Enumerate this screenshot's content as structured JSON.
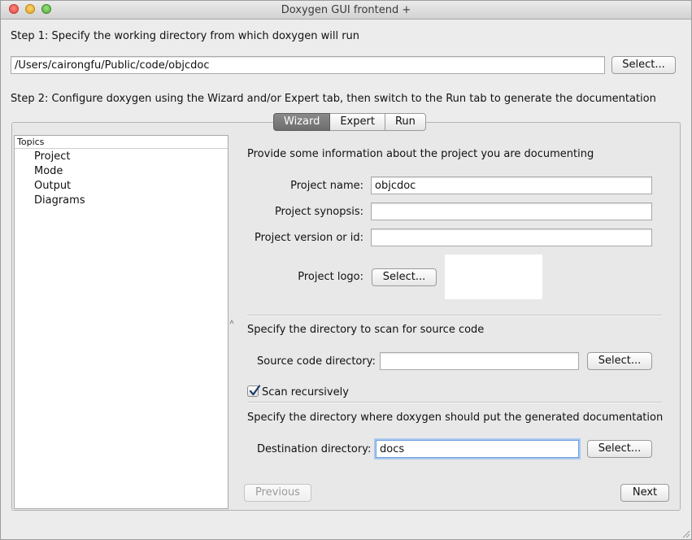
{
  "window": {
    "title": "Doxygen GUI frontend +"
  },
  "step1": {
    "label": "Step 1: Specify the working directory from which doxygen will run",
    "directory": "/Users/cairongfu/Public/code/objcdoc",
    "select_label": "Select..."
  },
  "step2": {
    "label": "Step 2: Configure doxygen using the Wizard and/or Expert tab, then switch to the Run tab to generate the documentation"
  },
  "tabs": [
    {
      "label": "Wizard",
      "active": true
    },
    {
      "label": "Expert",
      "active": false
    },
    {
      "label": "Run",
      "active": false
    }
  ],
  "topics": {
    "header": "Topics",
    "items": [
      "Project",
      "Mode",
      "Output",
      "Diagrams"
    ]
  },
  "project": {
    "intro": "Provide some information about the project you are documenting",
    "name_label": "Project name:",
    "name_value": "objcdoc",
    "synopsis_label": "Project synopsis:",
    "synopsis_value": "",
    "version_label": "Project version or id:",
    "version_value": "",
    "logo_label": "Project logo:",
    "logo_select_label": "Select..."
  },
  "source": {
    "intro": "Specify the directory to scan for source code",
    "dir_label": "Source code directory:",
    "dir_value": "",
    "select_label": "Select...",
    "recursive_label": "Scan recursively",
    "recursive_checked": true
  },
  "destination": {
    "intro": "Specify the directory where doxygen should put the generated documentation",
    "dir_label": "Destination directory:",
    "dir_value": "docs",
    "select_label": "Select..."
  },
  "nav": {
    "previous_label": "Previous",
    "previous_enabled": false,
    "next_label": "Next"
  }
}
